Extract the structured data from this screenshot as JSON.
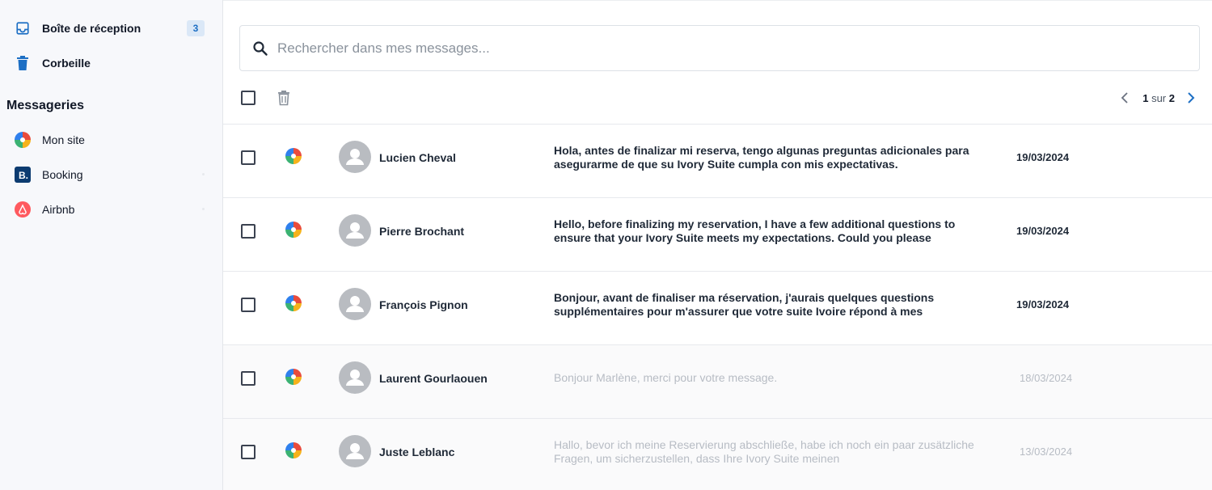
{
  "sidebar": {
    "inbox": {
      "label": "Boîte de réception",
      "count": "3",
      "icon": "inbox-icon"
    },
    "trash": {
      "label": "Corbeille",
      "icon": "trash-icon"
    },
    "section_title": "Messageries",
    "channels": [
      {
        "label": "Mon site",
        "icon": "colorful-site-logo-icon"
      },
      {
        "label": "Booking",
        "icon": "booking-logo-icon"
      },
      {
        "label": "Airbnb",
        "icon": "airbnb-logo-icon"
      }
    ]
  },
  "search": {
    "placeholder": "Rechercher dans mes messages..."
  },
  "pagination": {
    "current": "1",
    "separator": "sur",
    "total": "2"
  },
  "colors": {
    "accent": "#1d6fc4",
    "badge_bg": "#dbe8f7",
    "sidebar_bg": "#f7f8fb",
    "avatar": "#b9bcc1",
    "read_text": "#b7bcc4"
  },
  "messages": [
    {
      "sender": "Lucien Cheval",
      "preview": "Hola, antes de finalizar mi reserva, tengo algunas preguntas adicionales para asegurarme de que su Ivory Suite cumpla con mis expectativas.",
      "date": "19/03/2024",
      "unread": true
    },
    {
      "sender": "Pierre Brochant",
      "preview": "Hello, before finalizing my reservation, I have a few additional questions to ensure that your Ivory Suite meets my expectations. Could you please",
      "date": "19/03/2024",
      "unread": true
    },
    {
      "sender": "François Pignon",
      "preview": "Bonjour, avant de finaliser ma réservation, j'aurais quelques questions supplémentaires pour m'assurer que votre suite Ivoire répond à mes",
      "date": "19/03/2024",
      "unread": true
    },
    {
      "sender": "Laurent Gourlaouen",
      "preview": "Bonjour Marlène, merci pour votre message.",
      "date": "18/03/2024",
      "unread": false
    },
    {
      "sender": "Juste Leblanc",
      "preview": "Hallo, bevor ich meine Reservierung abschließe, habe ich noch ein paar zusätzliche Fragen, um sicherzustellen, dass Ihre Ivory Suite meinen",
      "date": "13/03/2024",
      "unread": false
    }
  ]
}
